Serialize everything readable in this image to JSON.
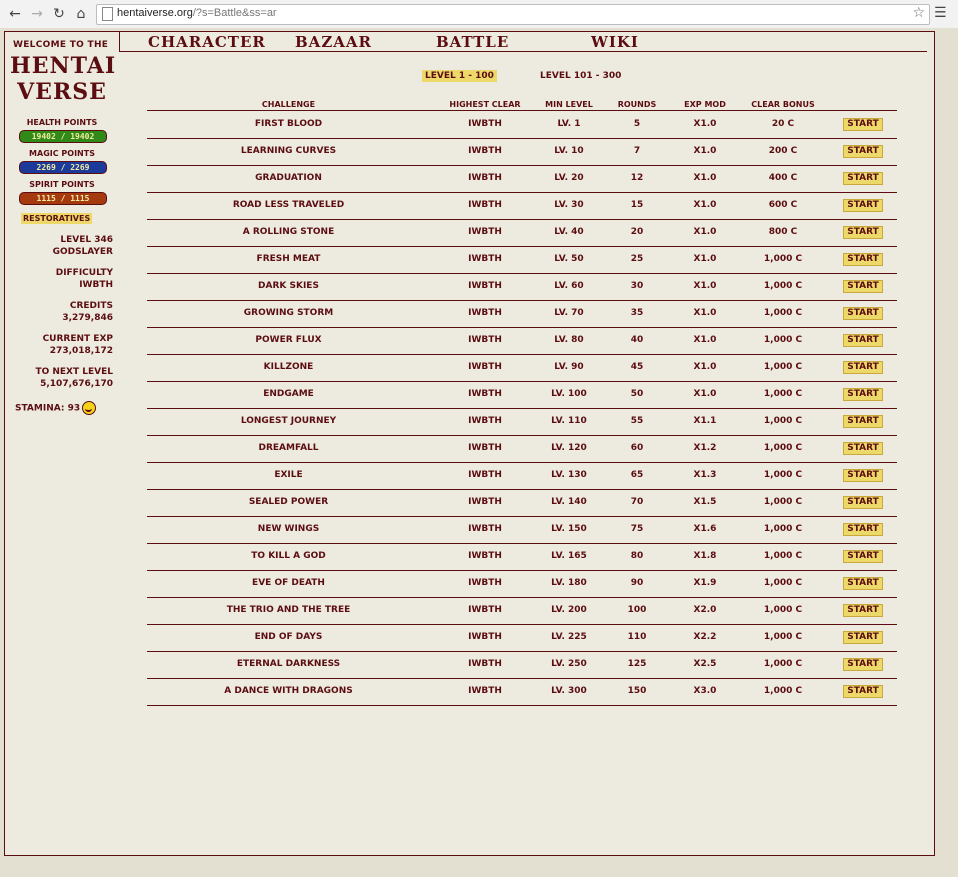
{
  "browser": {
    "url_host": "hentaiverse.org",
    "url_path": "/?s=Battle&ss=ar"
  },
  "sidebar": {
    "welcome": "WELCOME TO THE",
    "logo_line1": "HENTAI",
    "logo_line2": "VERSE",
    "health_label": "HEALTH POINTS",
    "health_value": "19402 / 19402",
    "magic_label": "MAGIC POINTS",
    "magic_value": "2269 / 2269",
    "spirit_label": "SPIRIT POINTS",
    "spirit_value": "1115 / 1115",
    "restoratives": "RESTORATIVES",
    "level": "LEVEL 346",
    "title": "GODSLAYER",
    "difficulty_label": "DIFFICULTY",
    "difficulty_value": "IWBTH",
    "credits_label": "CREDITS",
    "credits_value": "3,279,846",
    "exp_label": "CURRENT EXP",
    "exp_value": "273,018,172",
    "next_label": "TO NEXT LEVEL",
    "next_value": "5,107,676,170",
    "stamina": "STAMINA: 93"
  },
  "nav": {
    "character": "CHARACTER",
    "bazaar": "BAZAAR",
    "battle": "BATTLE",
    "wiki": "WIKI"
  },
  "tabs": {
    "tab1": "LEVEL 1 - 100",
    "tab2": "LEVEL 101 - 300"
  },
  "table": {
    "headers": [
      "CHALLENGE",
      "HIGHEST CLEAR",
      "MIN LEVEL",
      "ROUNDS",
      "EXP MOD",
      "CLEAR BONUS"
    ],
    "start_label": "START",
    "rows": [
      [
        "FIRST BLOOD",
        "IWBTH",
        "LV. 1",
        "5",
        "X1.0",
        "20 C"
      ],
      [
        "LEARNING CURVES",
        "IWBTH",
        "LV. 10",
        "7",
        "X1.0",
        "200 C"
      ],
      [
        "GRADUATION",
        "IWBTH",
        "LV. 20",
        "12",
        "X1.0",
        "400 C"
      ],
      [
        "ROAD LESS TRAVELED",
        "IWBTH",
        "LV. 30",
        "15",
        "X1.0",
        "600 C"
      ],
      [
        "A ROLLING STONE",
        "IWBTH",
        "LV. 40",
        "20",
        "X1.0",
        "800 C"
      ],
      [
        "FRESH MEAT",
        "IWBTH",
        "LV. 50",
        "25",
        "X1.0",
        "1,000 C"
      ],
      [
        "DARK SKIES",
        "IWBTH",
        "LV. 60",
        "30",
        "X1.0",
        "1,000 C"
      ],
      [
        "GROWING STORM",
        "IWBTH",
        "LV. 70",
        "35",
        "X1.0",
        "1,000 C"
      ],
      [
        "POWER FLUX",
        "IWBTH",
        "LV. 80",
        "40",
        "X1.0",
        "1,000 C"
      ],
      [
        "KILLZONE",
        "IWBTH",
        "LV. 90",
        "45",
        "X1.0",
        "1,000 C"
      ],
      [
        "ENDGAME",
        "IWBTH",
        "LV. 100",
        "50",
        "X1.0",
        "1,000 C"
      ],
      [
        "LONGEST JOURNEY",
        "IWBTH",
        "LV. 110",
        "55",
        "X1.1",
        "1,000 C"
      ],
      [
        "DREAMFALL",
        "IWBTH",
        "LV. 120",
        "60",
        "X1.2",
        "1,000 C"
      ],
      [
        "EXILE",
        "IWBTH",
        "LV. 130",
        "65",
        "X1.3",
        "1,000 C"
      ],
      [
        "SEALED POWER",
        "IWBTH",
        "LV. 140",
        "70",
        "X1.5",
        "1,000 C"
      ],
      [
        "NEW WINGS",
        "IWBTH",
        "LV. 150",
        "75",
        "X1.6",
        "1,000 C"
      ],
      [
        "TO KILL A GOD",
        "IWBTH",
        "LV. 165",
        "80",
        "X1.8",
        "1,000 C"
      ],
      [
        "EVE OF DEATH",
        "IWBTH",
        "LV. 180",
        "90",
        "X1.9",
        "1,000 C"
      ],
      [
        "THE TRIO AND THE TREE",
        "IWBTH",
        "LV. 200",
        "100",
        "X2.0",
        "1,000 C"
      ],
      [
        "END OF DAYS",
        "IWBTH",
        "LV. 225",
        "110",
        "X2.2",
        "1,000 C"
      ],
      [
        "ETERNAL DARKNESS",
        "IWBTH",
        "LV. 250",
        "125",
        "X2.5",
        "1,000 C"
      ],
      [
        "A DANCE WITH DRAGONS",
        "IWBTH",
        "LV. 300",
        "150",
        "X3.0",
        "1,000 C"
      ]
    ]
  }
}
